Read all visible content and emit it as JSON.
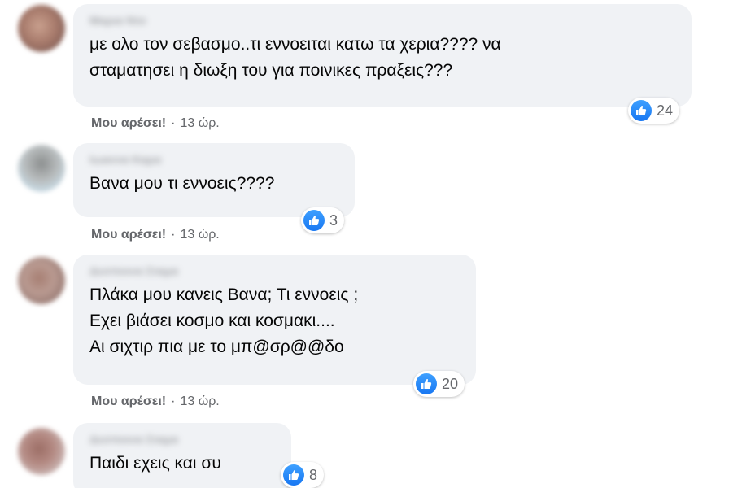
{
  "comments": [
    {
      "author": "Μαρια Ντο",
      "text": "με ολο τον σεβασμο..τι εννοειται κατω τα χερια???? να\nσταματησει η διωξη του για ποινικες πραξεις???",
      "reaction_count": "24",
      "like_label": "Μου αρέσει!",
      "separator": "·",
      "time": "13 ώρ."
    },
    {
      "author": "Ιωαννα Καρα",
      "text": "Βανα μου τι εννοεις????",
      "reaction_count": "3",
      "like_label": "Μου αρέσει!",
      "separator": "·",
      "time": "13 ώρ."
    },
    {
      "author": "Δεσποινα Σταμα",
      "text": "Πλάκα μου κανεις Βανα; Τι εννοεις ;\nΕχει βιάσει κοσμο και κοσμακι....\nΑι σιχτιρ πια με το μπ@σρ@@δο",
      "reaction_count": "20",
      "like_label": "Μου αρέσει!",
      "separator": "·",
      "time": "13 ώρ."
    },
    {
      "author": "Δεσποινα Σταμα",
      "text": "Παιδι εχεις και συ",
      "reaction_count": "8"
    }
  ],
  "icons": {
    "reaction": "like-thumbs-up-icon",
    "reaction_color": "#1877f2"
  }
}
